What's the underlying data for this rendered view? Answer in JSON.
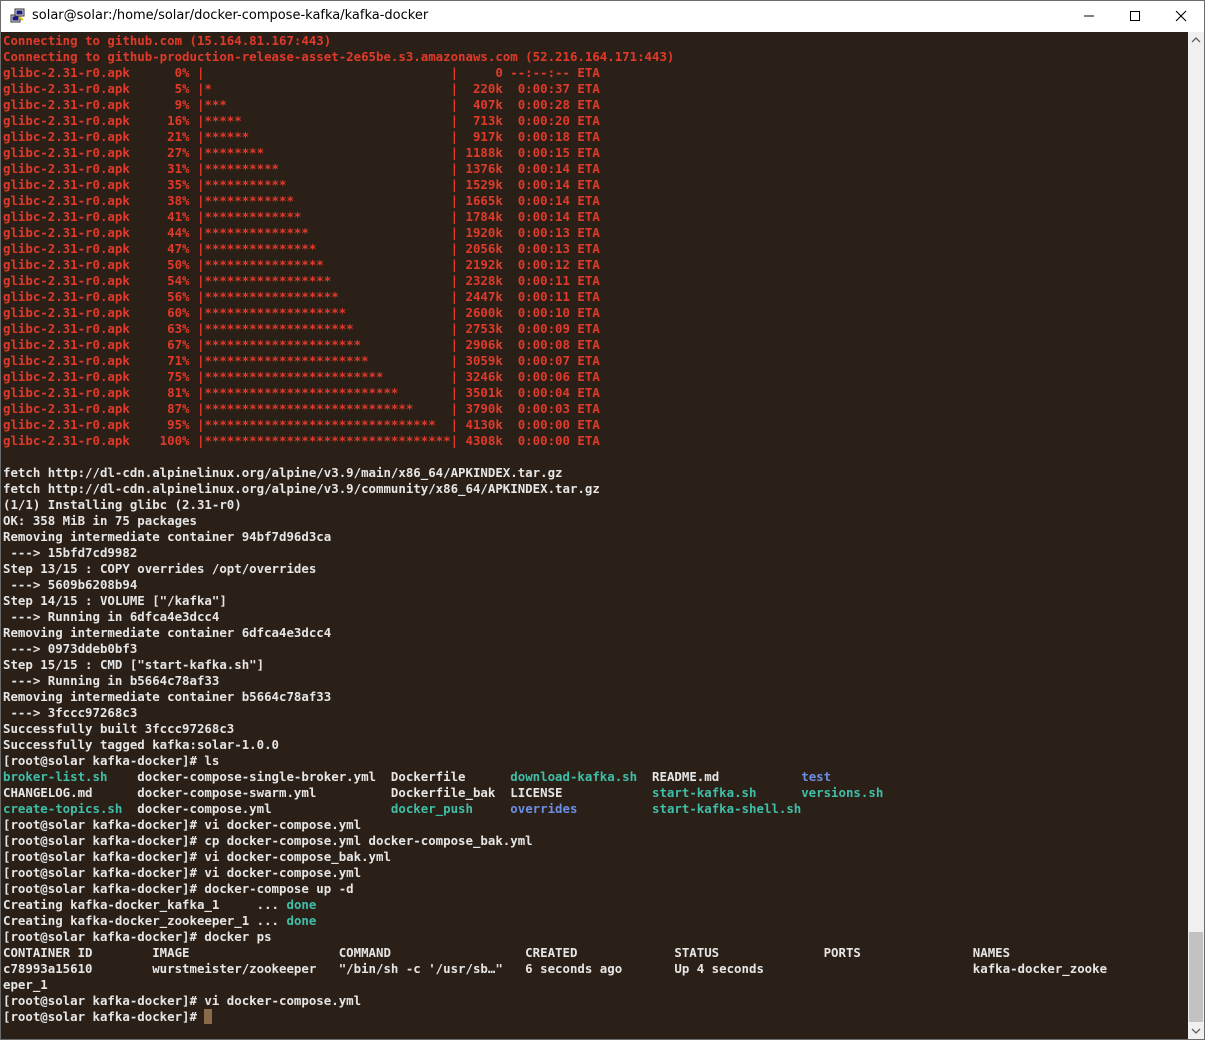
{
  "window": {
    "title": "solar@solar:/home/solar/docker-compose-kafka/kafka-docker",
    "icons": {
      "app": "putty-icon",
      "minimize": "minimize-icon",
      "maximize": "maximize-icon",
      "close": "close-icon"
    }
  },
  "terminal": {
    "lines": [
      [
        {
          "t": "Connecting to github.com (15.164.81.167:443)",
          "c": "red"
        }
      ],
      [
        {
          "t": "Connecting to github-production-release-asset-2e65be.s3.amazonaws.com (52.216.164.171:443)",
          "c": "red"
        }
      ],
      [
        {
          "t": "glibc-2.31-r0.apk      0% |                                 |     0 --:--:-- ETA",
          "c": "red"
        }
      ],
      [
        {
          "t": "glibc-2.31-r0.apk      5% |*                                |  220k  0:00:37 ETA",
          "c": "red"
        }
      ],
      [
        {
          "t": "glibc-2.31-r0.apk      9% |***                              |  407k  0:00:28 ETA",
          "c": "red"
        }
      ],
      [
        {
          "t": "glibc-2.31-r0.apk     16% |*****                            |  713k  0:00:20 ETA",
          "c": "red"
        }
      ],
      [
        {
          "t": "glibc-2.31-r0.apk     21% |******                           |  917k  0:00:18 ETA",
          "c": "red"
        }
      ],
      [
        {
          "t": "glibc-2.31-r0.apk     27% |********                         | 1188k  0:00:15 ETA",
          "c": "red"
        }
      ],
      [
        {
          "t": "glibc-2.31-r0.apk     31% |**********                       | 1376k  0:00:14 ETA",
          "c": "red"
        }
      ],
      [
        {
          "t": "glibc-2.31-r0.apk     35% |***********                      | 1529k  0:00:14 ETA",
          "c": "red"
        }
      ],
      [
        {
          "t": "glibc-2.31-r0.apk     38% |************                     | 1665k  0:00:14 ETA",
          "c": "red"
        }
      ],
      [
        {
          "t": "glibc-2.31-r0.apk     41% |*************                    | 1784k  0:00:14 ETA",
          "c": "red"
        }
      ],
      [
        {
          "t": "glibc-2.31-r0.apk     44% |**************                   | 1920k  0:00:13 ETA",
          "c": "red"
        }
      ],
      [
        {
          "t": "glibc-2.31-r0.apk     47% |***************                  | 2056k  0:00:13 ETA",
          "c": "red"
        }
      ],
      [
        {
          "t": "glibc-2.31-r0.apk     50% |****************                 | 2192k  0:00:12 ETA",
          "c": "red"
        }
      ],
      [
        {
          "t": "glibc-2.31-r0.apk     54% |*****************                | 2328k  0:00:11 ETA",
          "c": "red"
        }
      ],
      [
        {
          "t": "glibc-2.31-r0.apk     56% |******************               | 2447k  0:00:11 ETA",
          "c": "red"
        }
      ],
      [
        {
          "t": "glibc-2.31-r0.apk     60% |*******************              | 2600k  0:00:10 ETA",
          "c": "red"
        }
      ],
      [
        {
          "t": "glibc-2.31-r0.apk     63% |********************             | 2753k  0:00:09 ETA",
          "c": "red"
        }
      ],
      [
        {
          "t": "glibc-2.31-r0.apk     67% |*********************            | 2906k  0:00:08 ETA",
          "c": "red"
        }
      ],
      [
        {
          "t": "glibc-2.31-r0.apk     71% |**********************           | 3059k  0:00:07 ETA",
          "c": "red"
        }
      ],
      [
        {
          "t": "glibc-2.31-r0.apk     75% |************************         | 3246k  0:00:06 ETA",
          "c": "red"
        }
      ],
      [
        {
          "t": "glibc-2.31-r0.apk     81% |**************************       | 3501k  0:00:04 ETA",
          "c": "red"
        }
      ],
      [
        {
          "t": "glibc-2.31-r0.apk     87% |****************************     | 3790k  0:00:03 ETA",
          "c": "red"
        }
      ],
      [
        {
          "t": "glibc-2.31-r0.apk     95% |*******************************  | 4130k  0:00:00 ETA",
          "c": "red"
        }
      ],
      [
        {
          "t": "glibc-2.31-r0.apk    100% |*********************************| 4308k  0:00:00 ETA",
          "c": "red"
        }
      ],
      [
        {
          "t": ""
        }
      ],
      [
        {
          "t": "fetch http://dl-cdn.alpinelinux.org/alpine/v3.9/main/x86_64/APKINDEX.tar.gz"
        }
      ],
      [
        {
          "t": "fetch http://dl-cdn.alpinelinux.org/alpine/v3.9/community/x86_64/APKINDEX.tar.gz"
        }
      ],
      [
        {
          "t": "(1/1) Installing glibc (2.31-r0)"
        }
      ],
      [
        {
          "t": "OK: 358 MiB in 75 packages"
        }
      ],
      [
        {
          "t": "Removing intermediate container 94bf7d96d3ca"
        }
      ],
      [
        {
          "t": " ---> 15bfd7cd9982"
        }
      ],
      [
        {
          "t": "Step 13/15 : COPY overrides /opt/overrides"
        }
      ],
      [
        {
          "t": " ---> 5609b6208b94"
        }
      ],
      [
        {
          "t": "Step 14/15 : VOLUME [\"/kafka\"]"
        }
      ],
      [
        {
          "t": " ---> Running in 6dfca4e3dcc4"
        }
      ],
      [
        {
          "t": "Removing intermediate container 6dfca4e3dcc4"
        }
      ],
      [
        {
          "t": " ---> 0973ddeb0bf3"
        }
      ],
      [
        {
          "t": "Step 15/15 : CMD [\"start-kafka.sh\"]"
        }
      ],
      [
        {
          "t": " ---> Running in b5664c78af33"
        }
      ],
      [
        {
          "t": "Removing intermediate container b5664c78af33"
        }
      ],
      [
        {
          "t": " ---> 3fccc97268c3"
        }
      ],
      [
        {
          "t": "Successfully built 3fccc97268c3"
        }
      ],
      [
        {
          "t": "Successfully tagged kafka:solar-1.0.0"
        }
      ],
      [
        {
          "t": "[root@solar kafka-docker]# ls"
        }
      ],
      [
        {
          "t": "broker-list.sh",
          "c": "green"
        },
        {
          "t": "    docker-compose-single-broker.yml  Dockerfile      "
        },
        {
          "t": "download-kafka.sh",
          "c": "green"
        },
        {
          "t": "  README.md           "
        },
        {
          "t": "test",
          "c": "blue"
        }
      ],
      [
        {
          "t": "CHANGELOG.md      docker-compose-swarm.yml          Dockerfile_bak  LICENSE            "
        },
        {
          "t": "start-kafka.sh",
          "c": "green"
        },
        {
          "t": "      "
        },
        {
          "t": "versions.sh",
          "c": "green"
        }
      ],
      [
        {
          "t": "create-topics.sh",
          "c": "green"
        },
        {
          "t": "  docker-compose.yml                "
        },
        {
          "t": "docker_push",
          "c": "green"
        },
        {
          "t": "     "
        },
        {
          "t": "overrides",
          "c": "blue"
        },
        {
          "t": "          "
        },
        {
          "t": "start-kafka-shell.sh",
          "c": "green"
        }
      ],
      [
        {
          "t": "[root@solar kafka-docker]# vi docker-compose.yml"
        }
      ],
      [
        {
          "t": "[root@solar kafka-docker]# cp docker-compose.yml docker-compose_bak.yml"
        }
      ],
      [
        {
          "t": "[root@solar kafka-docker]# vi docker-compose_bak.yml"
        }
      ],
      [
        {
          "t": "[root@solar kafka-docker]# vi docker-compose.yml"
        }
      ],
      [
        {
          "t": "[root@solar kafka-docker]# docker-compose up -d"
        }
      ],
      [
        {
          "t": "Creating kafka-docker_kafka_1     ... "
        },
        {
          "t": "done",
          "c": "green"
        }
      ],
      [
        {
          "t": "Creating kafka-docker_zookeeper_1 ... "
        },
        {
          "t": "done",
          "c": "green"
        }
      ],
      [
        {
          "t": "[root@solar kafka-docker]# docker ps"
        }
      ],
      [
        {
          "t": "CONTAINER ID        IMAGE                    COMMAND                  CREATED             STATUS              PORTS               NAMES"
        }
      ],
      [
        {
          "t": "c78993a15610        wurstmeister/zookeeper   \"/bin/sh -c '/usr/sb…\"   6 seconds ago       Up 4 seconds                            kafka-docker_zooke"
        }
      ],
      [
        {
          "t": "eper_1"
        }
      ],
      [
        {
          "t": "[root@solar kafka-docker]# vi docker-compose.yml"
        }
      ],
      [
        {
          "t": "[root@solar kafka-docker]# "
        },
        {
          "t": "",
          "cursor": true
        }
      ]
    ]
  }
}
